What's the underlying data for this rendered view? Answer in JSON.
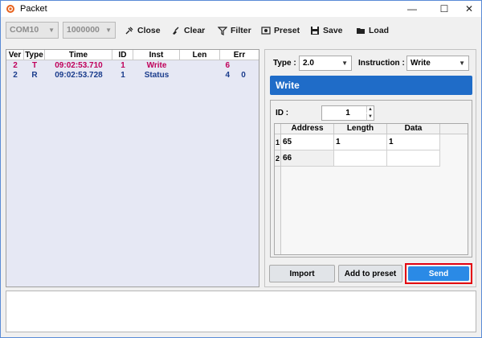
{
  "window": {
    "title": "Packet",
    "controls": {
      "minimize": "—",
      "maximize": "☐",
      "close": "✕"
    }
  },
  "toolbar": {
    "port": "COM10",
    "baud": "1000000",
    "buttons": [
      {
        "label": "Close",
        "icon": "plug-icon"
      },
      {
        "label": "Clear",
        "icon": "broom-icon"
      },
      {
        "label": "Filter",
        "icon": "filter-icon"
      },
      {
        "label": "Preset",
        "icon": "preset-icon"
      },
      {
        "label": "Save",
        "icon": "save-icon"
      },
      {
        "label": "Load",
        "icon": "folder-icon"
      }
    ]
  },
  "packet_table": {
    "columns": [
      "Ver",
      "Type",
      "Time",
      "ID",
      "Inst",
      "Len",
      "Err"
    ],
    "rows": [
      {
        "ver": "2",
        "type": "T",
        "time": "09:02:53.710",
        "id": "1",
        "inst": "Write",
        "len": "6",
        "err": "",
        "color": "#c0005a"
      },
      {
        "ver": "2",
        "type": "R",
        "time": "09:02:53.728",
        "id": "1",
        "inst": "Status",
        "len": "4",
        "err": "0",
        "color": "#1a3c8c"
      }
    ]
  },
  "packet_editor": {
    "type_label": "Type :",
    "type_value": "2.0",
    "instruction_label": "Instruction :",
    "instruction_value": "Write",
    "banner": "Write",
    "id_label": "ID :",
    "id_value": "1",
    "params": {
      "columns": [
        "Address",
        "Length",
        "Data"
      ],
      "rows": [
        {
          "index": "1",
          "address": "65",
          "length": "1",
          "data": "1"
        },
        {
          "index": "2",
          "address": "66",
          "length": "",
          "data": ""
        }
      ]
    }
  },
  "actions": {
    "import": "Import",
    "add_to_preset": "Add to preset",
    "send": "Send"
  },
  "colors": {
    "accent": "#1f6cc8",
    "send_button": "#2a8ae6",
    "highlight": "#e3000f"
  }
}
